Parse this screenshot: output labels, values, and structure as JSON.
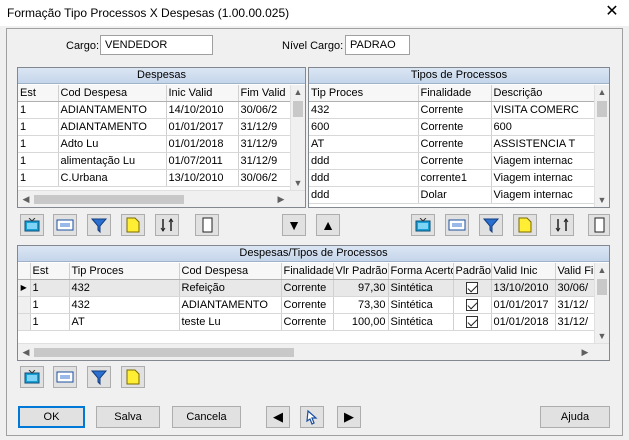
{
  "window": {
    "title": "Formação Tipo Processos X Despesas (1.00.00.025)",
    "close_glyph": "✕"
  },
  "header": {
    "cargo_label": "Cargo:",
    "cargo_value": "VENDEDOR",
    "nivel_label": "Nível Cargo:",
    "nivel_value": "PADRAO"
  },
  "despesas": {
    "title": "Despesas",
    "columns": [
      "Est",
      "Cod Despesa",
      "Inic Valid",
      "Fim Valid"
    ],
    "rows": [
      [
        "1",
        "ADIANTAMENTO",
        "14/10/2010",
        "30/06/2"
      ],
      [
        "1",
        "ADIANTAMENTO",
        "01/01/2017",
        "31/12/9"
      ],
      [
        "1",
        "Adto Lu",
        "01/01/2018",
        "31/12/9"
      ],
      [
        "1",
        "alimentação Lu",
        "01/07/2011",
        "31/12/9"
      ],
      [
        "1",
        "C.Urbana",
        "13/10/2010",
        "30/06/2"
      ]
    ]
  },
  "tipos": {
    "title": "Tipos de Processos",
    "columns": [
      "Tip Proces",
      "Finalidade",
      "Descrição"
    ],
    "rows": [
      [
        "432",
        "Corrente",
        "VISITA COMERC"
      ],
      [
        "600",
        "Corrente",
        "600"
      ],
      [
        "AT",
        "Corrente",
        "ASSISTENCIA T"
      ],
      [
        "ddd",
        "Corrente",
        "Viagem internac"
      ],
      [
        "ddd",
        "corrente1",
        "Viagem internac"
      ],
      [
        "ddd",
        "Dolar",
        "Viagem internac"
      ]
    ]
  },
  "rel": {
    "title": "Despesas/Tipos de Processos",
    "columns": [
      "Est",
      "Tip Proces",
      "Cod Despesa",
      "Finalidade",
      "Vlr Padrão",
      "Forma Acerto",
      "Padrão",
      "Valid Inic",
      "Valid Fir"
    ],
    "rows": [
      [
        "1",
        "432",
        "Refeição",
        "Corrente",
        "97,30",
        "Sintética",
        true,
        "13/10/2010",
        "30/06/"
      ],
      [
        "1",
        "432",
        "ADIANTAMENTO",
        "Corrente",
        "73,30",
        "Sintética",
        true,
        "01/01/2017",
        "31/12/"
      ],
      [
        "1",
        "AT",
        "teste Lu",
        "Corrente",
        "100,00",
        "Sintética",
        true,
        "01/01/2018",
        "31/12/"
      ]
    ]
  },
  "icons": {
    "toolbar": [
      "tv-icon",
      "film-icon",
      "funnel-icon",
      "note-icon",
      "sort-icon",
      "list-icon"
    ],
    "move_down": "▼",
    "move_up": "▲",
    "nav_prev": "◀",
    "nav_next": "▶",
    "pointer": "pointer-icon"
  },
  "footer": {
    "ok": "OK",
    "salva": "Salva",
    "cancela": "Cancela",
    "ajuda": "Ajuda"
  }
}
